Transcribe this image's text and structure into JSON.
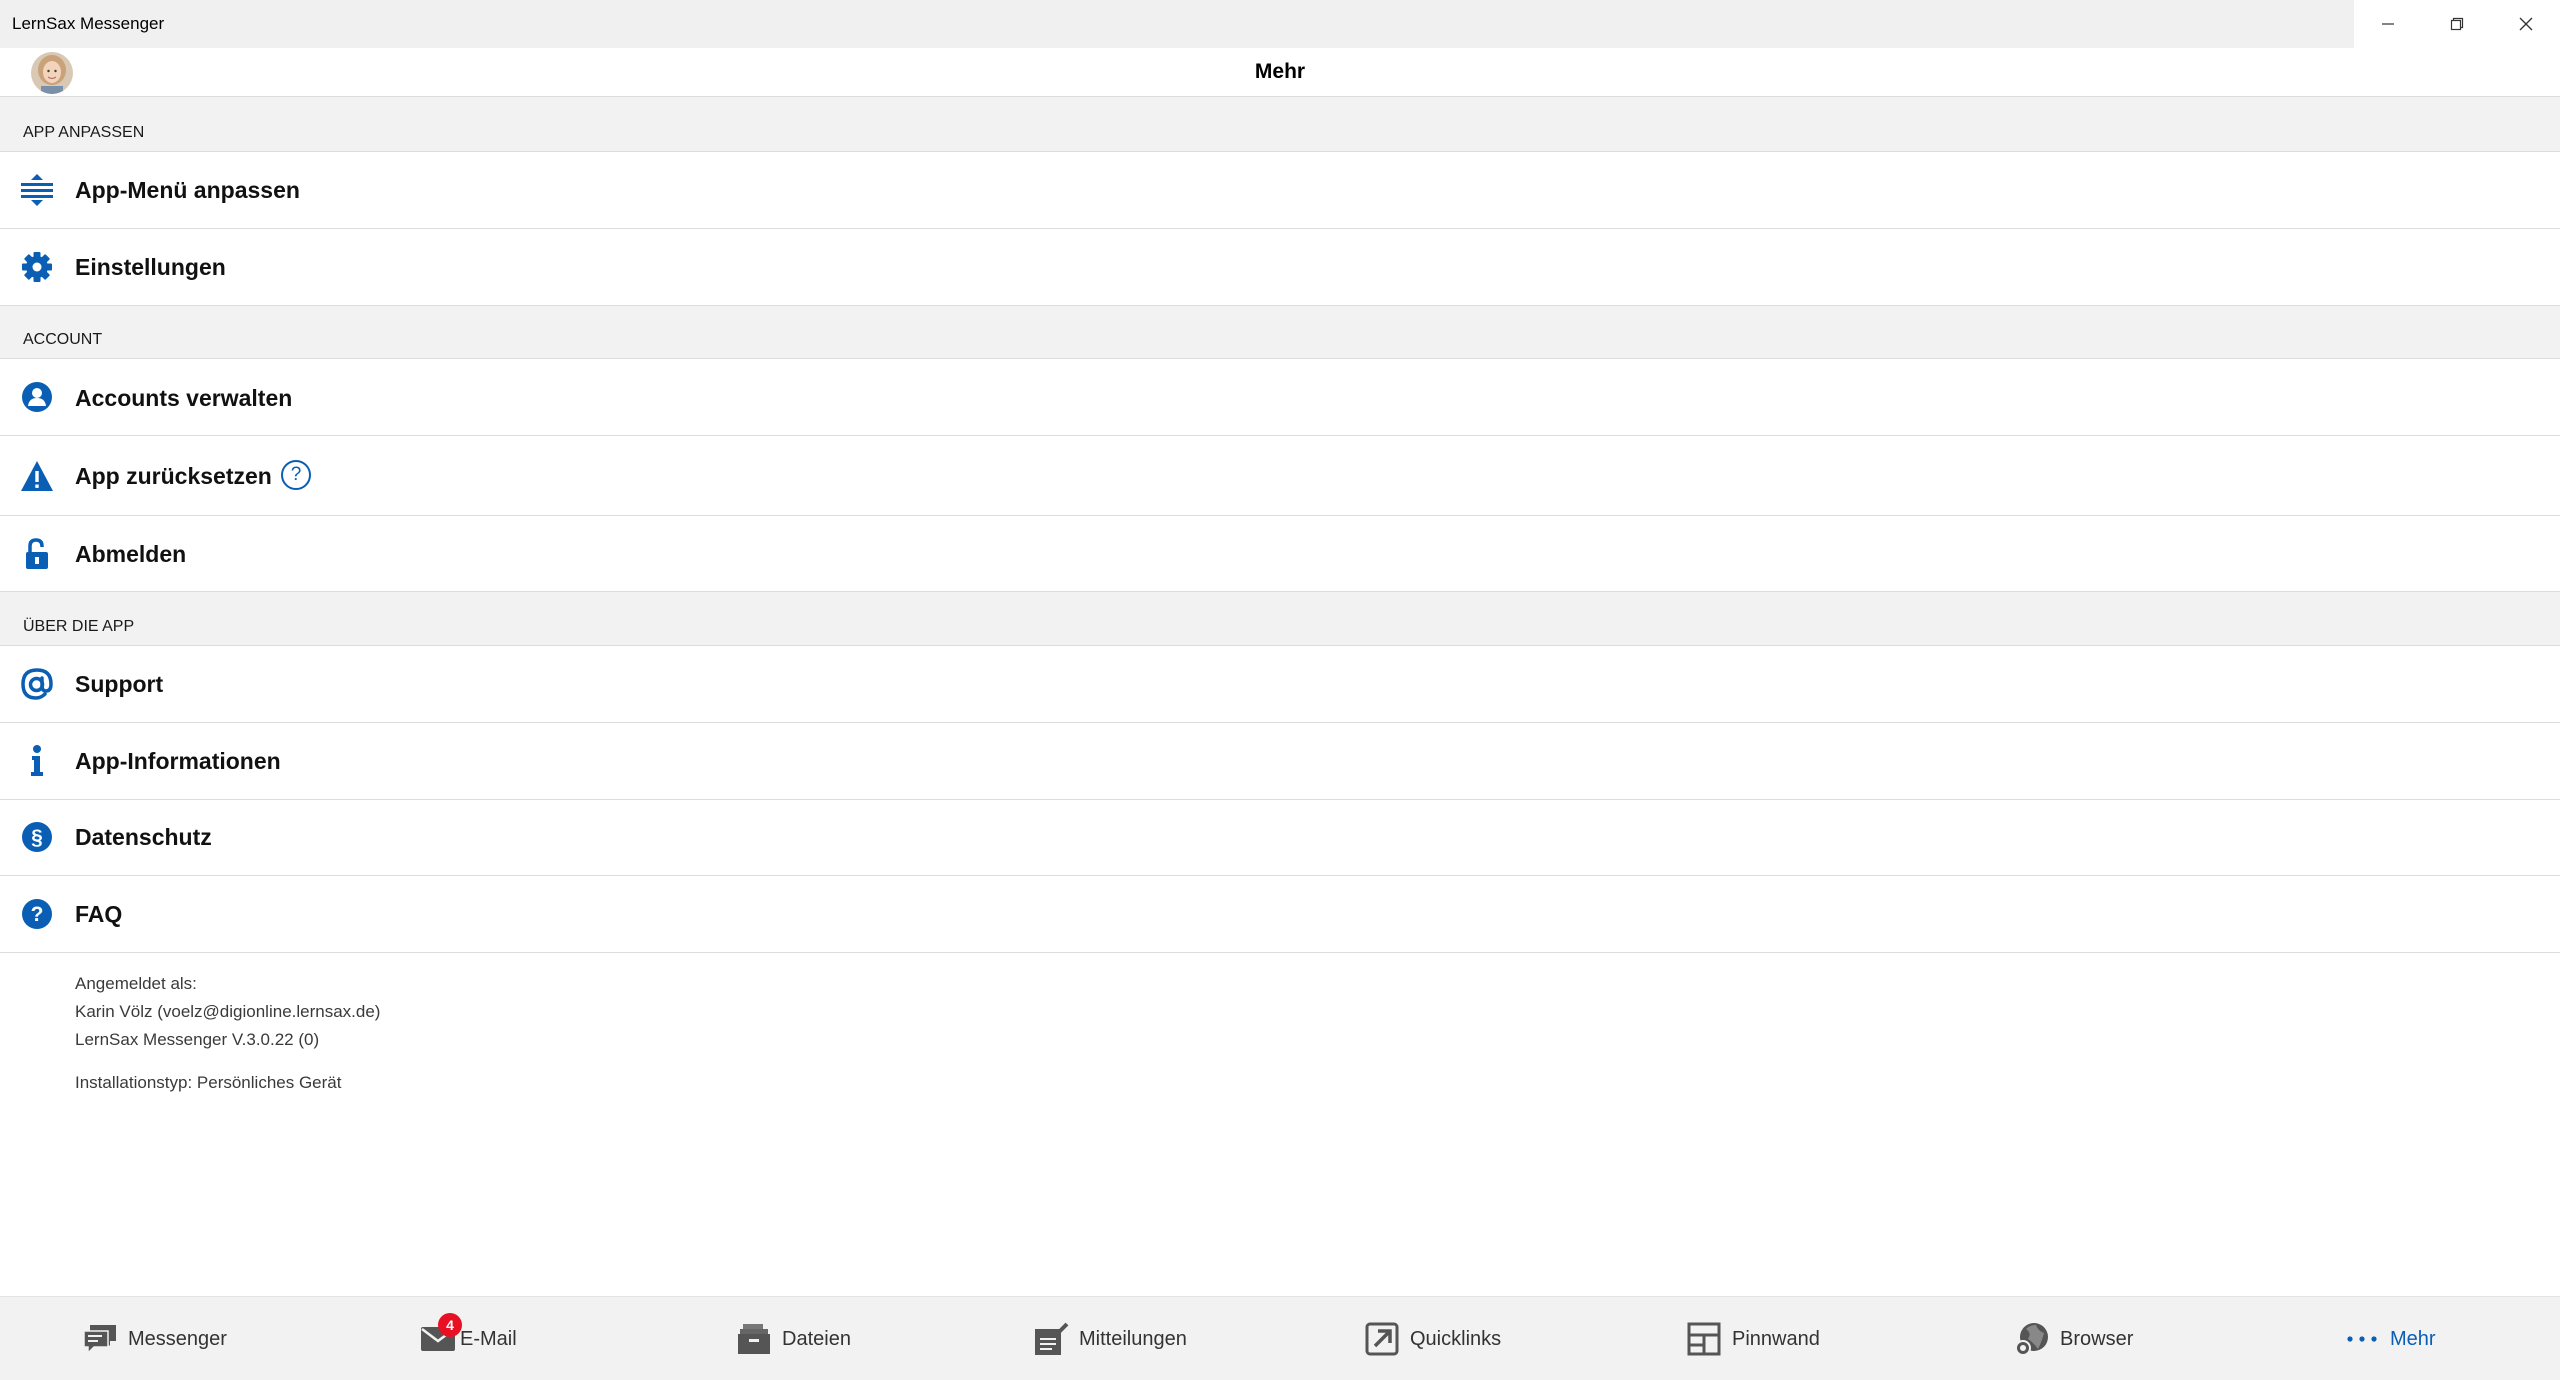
{
  "window": {
    "title": "LernSax Messenger",
    "controls": [
      "minimize",
      "restore",
      "close"
    ]
  },
  "header": {
    "title": "Mehr"
  },
  "sections": [
    {
      "label": "APP ANPASSEN",
      "items": [
        {
          "label": "App-Menü anpassen",
          "icon": "reorder-icon"
        },
        {
          "label": "Einstellungen",
          "icon": "gear-icon"
        }
      ]
    },
    {
      "label": "ACCOUNT",
      "items": [
        {
          "label": "Accounts verwalten",
          "icon": "person-icon"
        },
        {
          "label": "App zurücksetzen",
          "icon": "warning-icon",
          "help": "?"
        },
        {
          "label": "Abmelden",
          "icon": "unlock-icon"
        }
      ]
    },
    {
      "label": "ÜBER DIE APP",
      "items": [
        {
          "label": "Support",
          "icon": "at-icon"
        },
        {
          "label": "App-Informationen",
          "icon": "info-icon"
        },
        {
          "label": "Datenschutz",
          "icon": "paragraph-icon"
        },
        {
          "label": "FAQ",
          "icon": "question-icon"
        }
      ]
    }
  ],
  "info": {
    "logged_in_label": "Angemeldet als:",
    "user": "Karin Völz (voelz@digionline.lernsax.de)",
    "version": "LernSax Messenger V.3.0.22 (0)",
    "install_type": "Installationstyp: Persönliches Gerät"
  },
  "nav": {
    "items": [
      {
        "label": "Messenger",
        "icon": "chat-icon"
      },
      {
        "label": "E-Mail",
        "icon": "mail-icon",
        "badge": "4"
      },
      {
        "label": "Dateien",
        "icon": "files-icon"
      },
      {
        "label": "Mitteilungen",
        "icon": "notes-icon"
      },
      {
        "label": "Quicklinks",
        "icon": "quicklink-icon"
      },
      {
        "label": "Pinnwand",
        "icon": "board-icon"
      },
      {
        "label": "Browser",
        "icon": "globe-icon"
      },
      {
        "label": "Mehr",
        "icon": "more-icon"
      }
    ],
    "active": "Mehr"
  },
  "colors": {
    "accent": "#0a5fb4",
    "badge": "#e81123",
    "section_bg": "#f2f2f2",
    "divider": "#dcdcdc"
  }
}
